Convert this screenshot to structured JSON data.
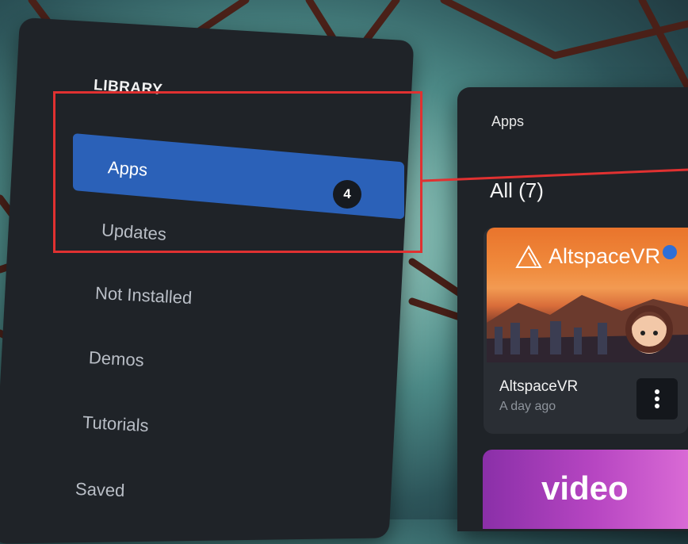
{
  "sidebar": {
    "section_title": "LIBRARY",
    "items": [
      {
        "label": "Apps",
        "badge": "4",
        "active": true
      },
      {
        "label": "Updates"
      },
      {
        "label": "Not Installed"
      },
      {
        "label": "Demos"
      },
      {
        "label": "Tutorials"
      },
      {
        "label": "Saved"
      }
    ]
  },
  "content": {
    "header": "Apps",
    "filter_heading": "All (7)",
    "apps": [
      {
        "name": "AltspaceVR",
        "logo_text": "AltspaceVR",
        "subtitle": "A day ago",
        "has_update_dot": true
      },
      {
        "name": "video",
        "logo_text": "video"
      }
    ]
  },
  "colors": {
    "panel": "#1f2328",
    "active_item": "#2b61b8",
    "highlight": "#e03131",
    "notify_dot": "#2f6fd6"
  }
}
